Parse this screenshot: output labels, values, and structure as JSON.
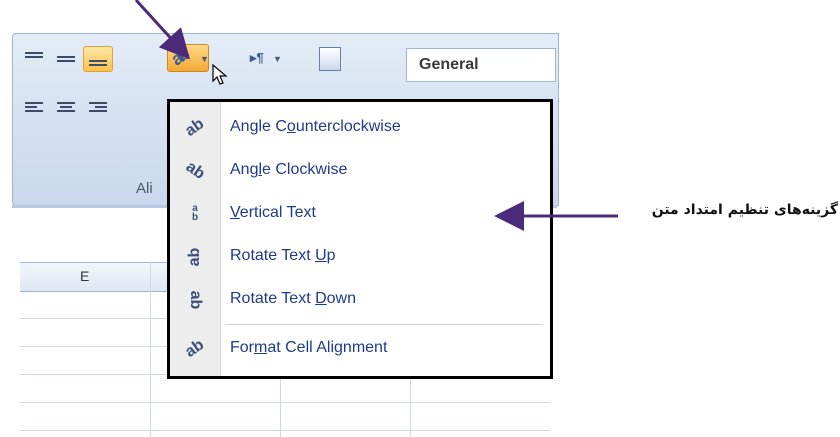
{
  "toolbar": {
    "number_format_value": "General",
    "group_label": "Ali",
    "alignment_buttons": [
      "align-top",
      "align-middle",
      "align-bottom",
      "orientation",
      "text-direction",
      "wrap-text",
      "align-left",
      "align-center",
      "align-right"
    ],
    "orientation_icon": "ab-rotated-icon"
  },
  "sheet": {
    "column_header": "E"
  },
  "menu": {
    "items": [
      {
        "icon": "angle-counterclockwise-icon",
        "prefix": "Angle C",
        "mnemonic": "o",
        "suffix": "unterclockwise"
      },
      {
        "icon": "angle-clockwise-icon",
        "prefix": "Ang",
        "mnemonic": "l",
        "suffix": "e Clockwise"
      },
      {
        "icon": "vertical-text-icon",
        "prefix": "",
        "mnemonic": "V",
        "suffix": "ertical Text"
      },
      {
        "icon": "rotate-text-up-icon",
        "prefix": "Rotate Text ",
        "mnemonic": "U",
        "suffix": "p"
      },
      {
        "icon": "rotate-text-down-icon",
        "prefix": "Rotate Text ",
        "mnemonic": "D",
        "suffix": "own"
      },
      {
        "icon": "format-cell-alignment-icon",
        "prefix": "For",
        "mnemonic": "m",
        "suffix": "at Cell Alignment"
      }
    ]
  },
  "annotation": {
    "text": "گزینه‌های تنظیم امتداد متن",
    "arrow_color": "#4b2a7a"
  }
}
